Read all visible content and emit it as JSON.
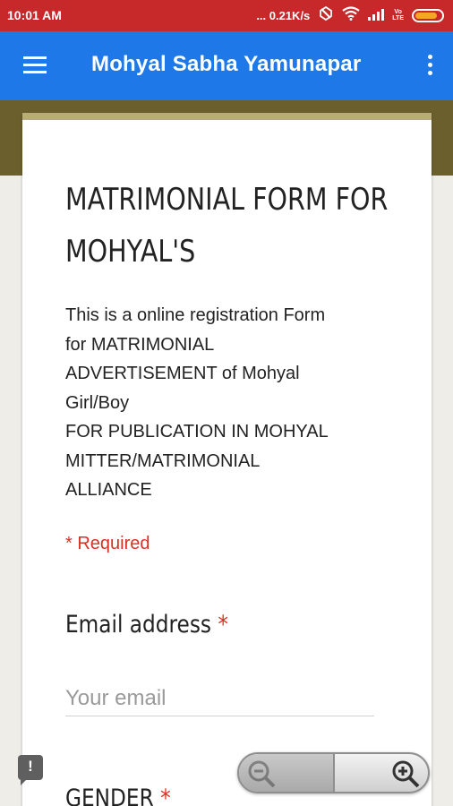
{
  "status_bar": {
    "time": "10:01 AM",
    "network_speed": "... 0.21K/s",
    "lte_label": "Vo\nLTE",
    "icons": [
      "no-disturb-icon",
      "wifi-icon",
      "signal-icon",
      "volte-icon",
      "battery-icon"
    ],
    "battery_level": 0.85
  },
  "app_bar": {
    "title": "Mohyal Sabha Yamunapar",
    "icons": [
      "menu-icon",
      "more-vert-icon"
    ]
  },
  "form": {
    "title": "MATRIMONIAL FORM FOR MOHYAL'S",
    "description": "This is a online registration Form\nfor  MATRIMONIAL\nADVERTISEMENT of Mohyal\nGirl/Boy\nFOR PUBLICATION IN MOHYAL\nMITTER/MATRIMONIAL\nALLIANCE",
    "required_note": "* Required",
    "fields": [
      {
        "label": "Email address",
        "required_mark": "*",
        "placeholder": "Your email",
        "value": ""
      },
      {
        "label": "GENDER",
        "required_mark": "*"
      }
    ]
  },
  "feedback": {
    "icon": "report-icon",
    "glyph": "!"
  },
  "zoom": {
    "icons": [
      "zoom-out-icon",
      "zoom-in-icon"
    ]
  },
  "colors": {
    "status_bar": "#c7292b",
    "app_bar": "#1f78e8",
    "banner": "#6b5f2e",
    "card_accent": "#b8ad79",
    "required": "#d93025"
  }
}
